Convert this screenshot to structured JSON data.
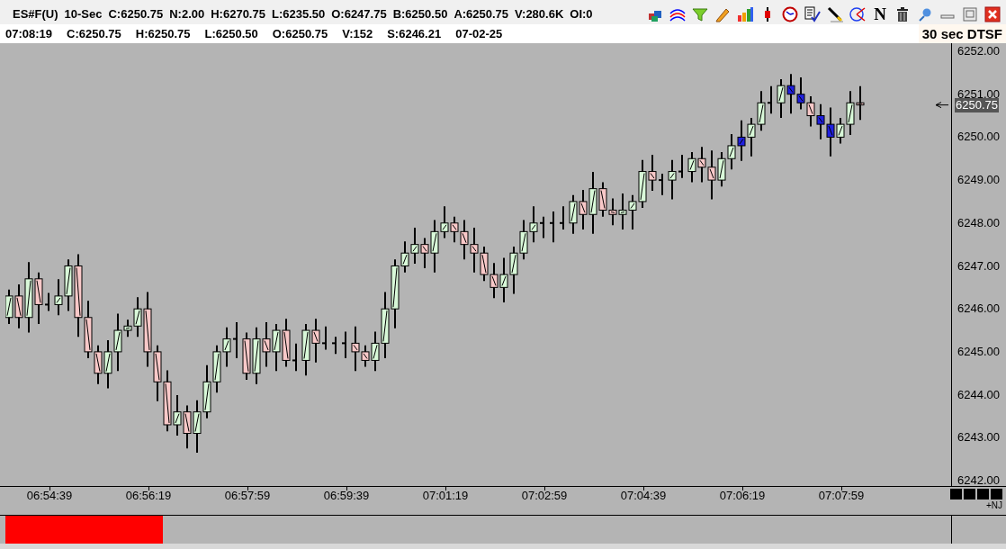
{
  "header": {
    "symbol": "ES#F(U)",
    "interval": "10-Sec",
    "quotes": [
      "C:6250.75",
      "N:2.00",
      "H:6270.75",
      "L:6235.50",
      "O:6247.75",
      "B:6250.50",
      "A:6250.75",
      "V:280.6K",
      "OI:0"
    ]
  },
  "toolbar": {
    "n_button": "N"
  },
  "bar_info": [
    "07:08:19",
    "C:6250.75",
    "H:6250.75",
    "L:6250.50",
    "O:6250.75",
    "V:152",
    "S:6246.21",
    "07-02-25"
  ],
  "chart_label": "30 sec DTSF",
  "price_axis": [
    "6252.00",
    "6251.00",
    "6250.00",
    "6249.00",
    "6248.00",
    "6247.00",
    "6246.00",
    "6245.00",
    "6244.00",
    "6243.00",
    "6242.00"
  ],
  "current_price": "6250.75",
  "time_axis": [
    "06:54:39",
    "06:56:19",
    "06:57:59",
    "06:59:39",
    "07:01:19",
    "07:02:59",
    "07:04:39",
    "07:06:19",
    "07:07:59"
  ],
  "indicator_label": "+NJ"
}
